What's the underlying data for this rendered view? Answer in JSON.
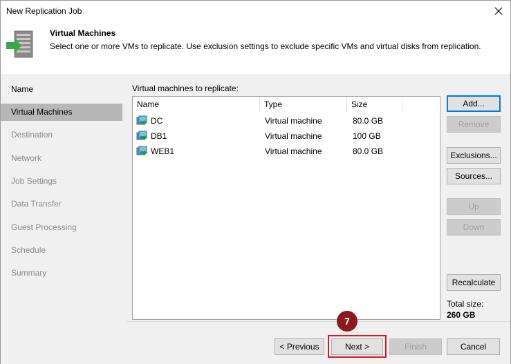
{
  "window": {
    "title": "New Replication Job"
  },
  "header": {
    "title": "Virtual Machines",
    "description": "Select one or more VMs to replicate. Use exclusion settings to exclude specific VMs and virtual disks from replication."
  },
  "sidebar": {
    "items": [
      {
        "label": "Name",
        "state": "done"
      },
      {
        "label": "Virtual Machines",
        "state": "active"
      },
      {
        "label": "Destination",
        "state": "pending"
      },
      {
        "label": "Network",
        "state": "pending"
      },
      {
        "label": "Job Settings",
        "state": "pending"
      },
      {
        "label": "Data Transfer",
        "state": "pending"
      },
      {
        "label": "Guest Processing",
        "state": "pending"
      },
      {
        "label": "Schedule",
        "state": "pending"
      },
      {
        "label": "Summary",
        "state": "pending"
      }
    ]
  },
  "main": {
    "list_label": "Virtual machines to replicate:",
    "columns": [
      "Name",
      "Type",
      "Size"
    ],
    "rows": [
      {
        "name": "DC",
        "type": "Virtual machine",
        "size": "80.0 GB"
      },
      {
        "name": "DB1",
        "type": "Virtual machine",
        "size": "100 GB"
      },
      {
        "name": "WEB1",
        "type": "Virtual machine",
        "size": "80.0 GB"
      }
    ],
    "buttons": {
      "add": "Add...",
      "remove": "Remove",
      "exclusions": "Exclusions...",
      "sources": "Sources...",
      "up": "Up",
      "down": "Down",
      "recalculate": "Recalculate"
    },
    "total_label": "Total size:",
    "total_value": "260 GB"
  },
  "footer": {
    "previous": "< Previous",
    "next": "Next >",
    "finish": "Finish",
    "cancel": "Cancel"
  },
  "annotation": {
    "step_number": "7",
    "color": "#8b1a1a",
    "highlight_color": "#e1141e"
  },
  "icons": {
    "window_close": "close-icon",
    "header": "replication-icon",
    "vm": "vm-icon"
  }
}
